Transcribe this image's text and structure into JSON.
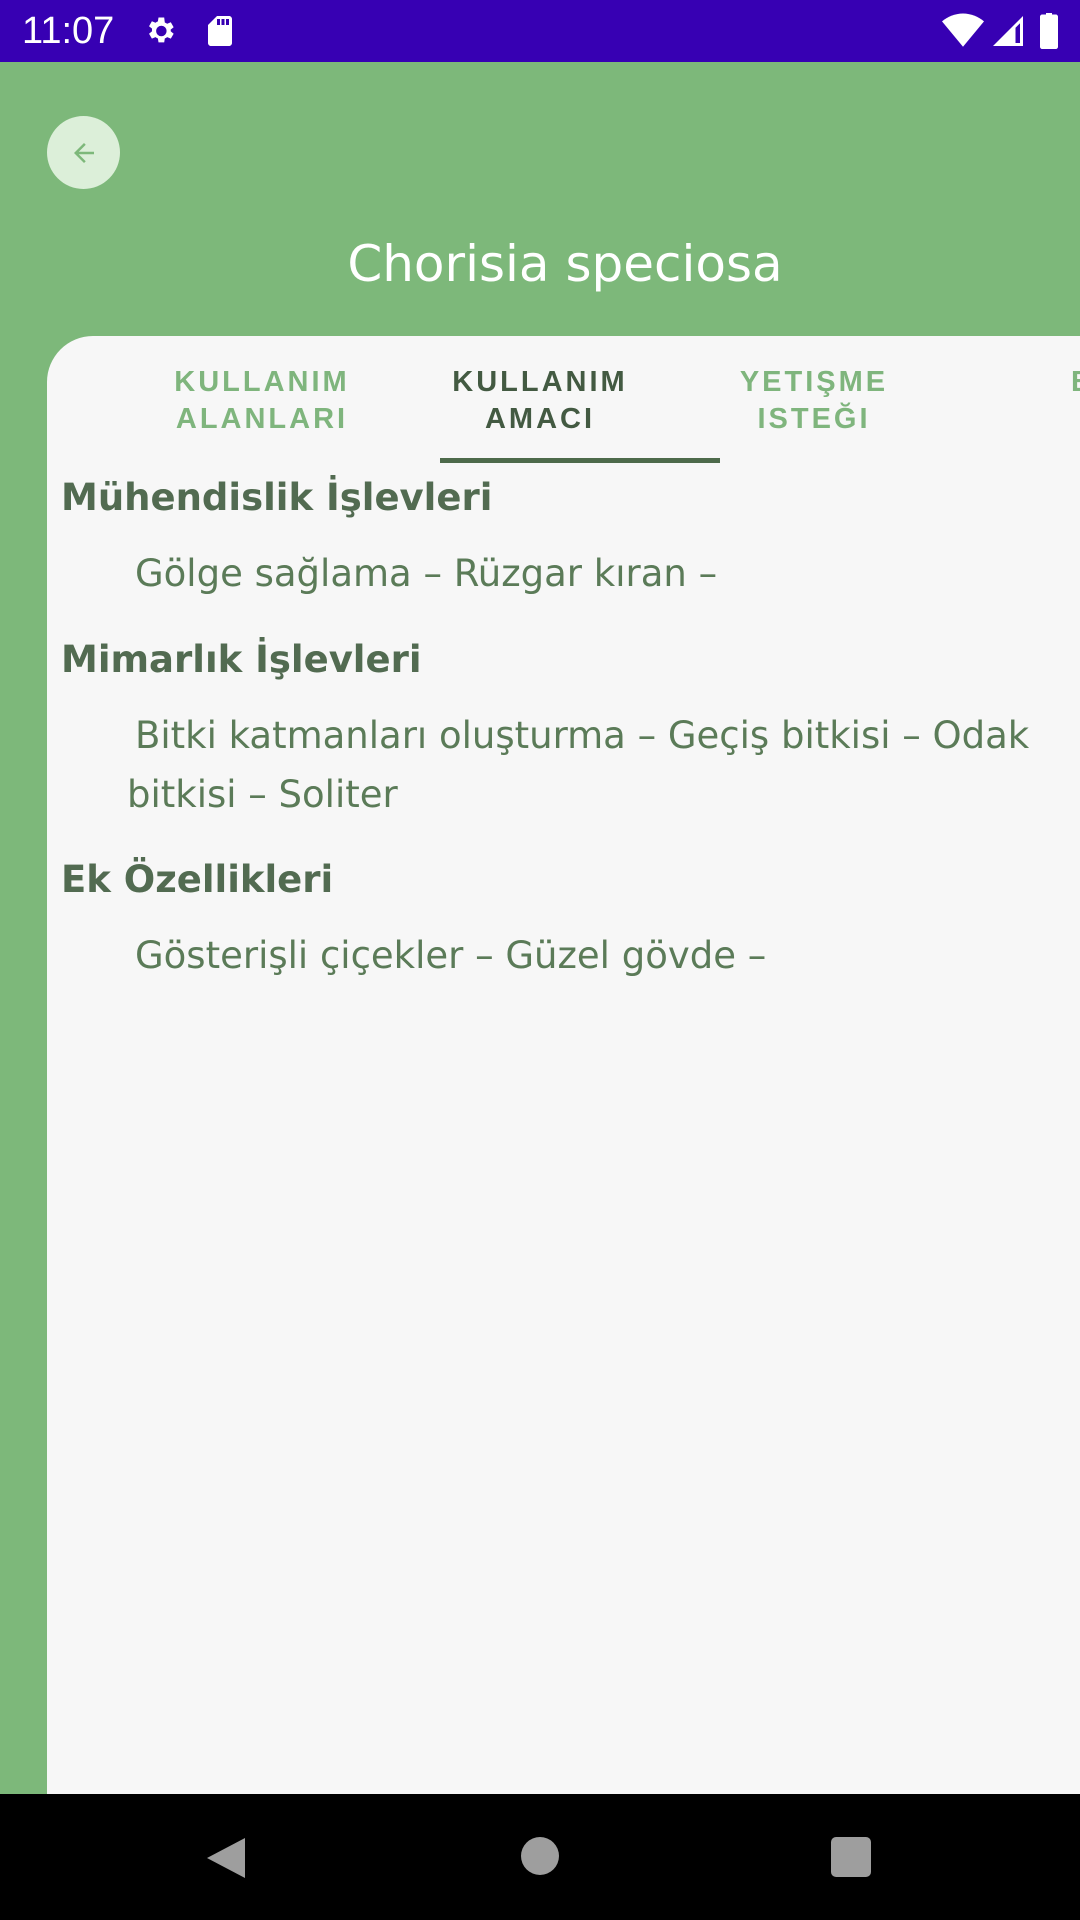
{
  "status_bar": {
    "time": "11:07",
    "icons": [
      "gear-icon",
      "sd-card-icon",
      "wifi-icon",
      "signal-icon",
      "battery-icon"
    ]
  },
  "header": {
    "back_icon": "arrow-left-icon",
    "title": "Chorisia speciosa"
  },
  "tabs": [
    {
      "label": "KULLANIM ALANLARI",
      "line1": "KULLANIM",
      "line2": "ALANLARI",
      "selected": false
    },
    {
      "label": "KULLANIM AMACI",
      "line1": "KULLANIM",
      "line2": "AMACI",
      "selected": true
    },
    {
      "label": "YETIŞME ISTEĞI",
      "line1": "YETIŞME",
      "line2": "ISTEĞI",
      "selected": false
    },
    {
      "label": "B",
      "line1": "",
      "line2": "B",
      "selected": false
    }
  ],
  "sections": [
    {
      "title": "Mühendislik İşlevleri",
      "text": "Gölge sağlama – Rüzgar kıran –"
    },
    {
      "title": "Mimarlık İşlevleri",
      "text": "Bitki katmanları oluşturma – Geçiş bitkisi – Odak bitkisi – Soliter"
    },
    {
      "title": "Ek Özellikleri",
      "text": "Gösterişli çiçekler – Güzel gövde –"
    }
  ],
  "nav_bar": {
    "icons": [
      "back-triangle-icon",
      "home-circle-icon",
      "recents-square-icon"
    ]
  },
  "colors": {
    "status_bar": "#3700b3",
    "header": "#7db87a",
    "sheet": "#f7f7f7",
    "tab_active": "#435a42",
    "tab_inactive": "#7fb57d",
    "text": "#526b51"
  }
}
